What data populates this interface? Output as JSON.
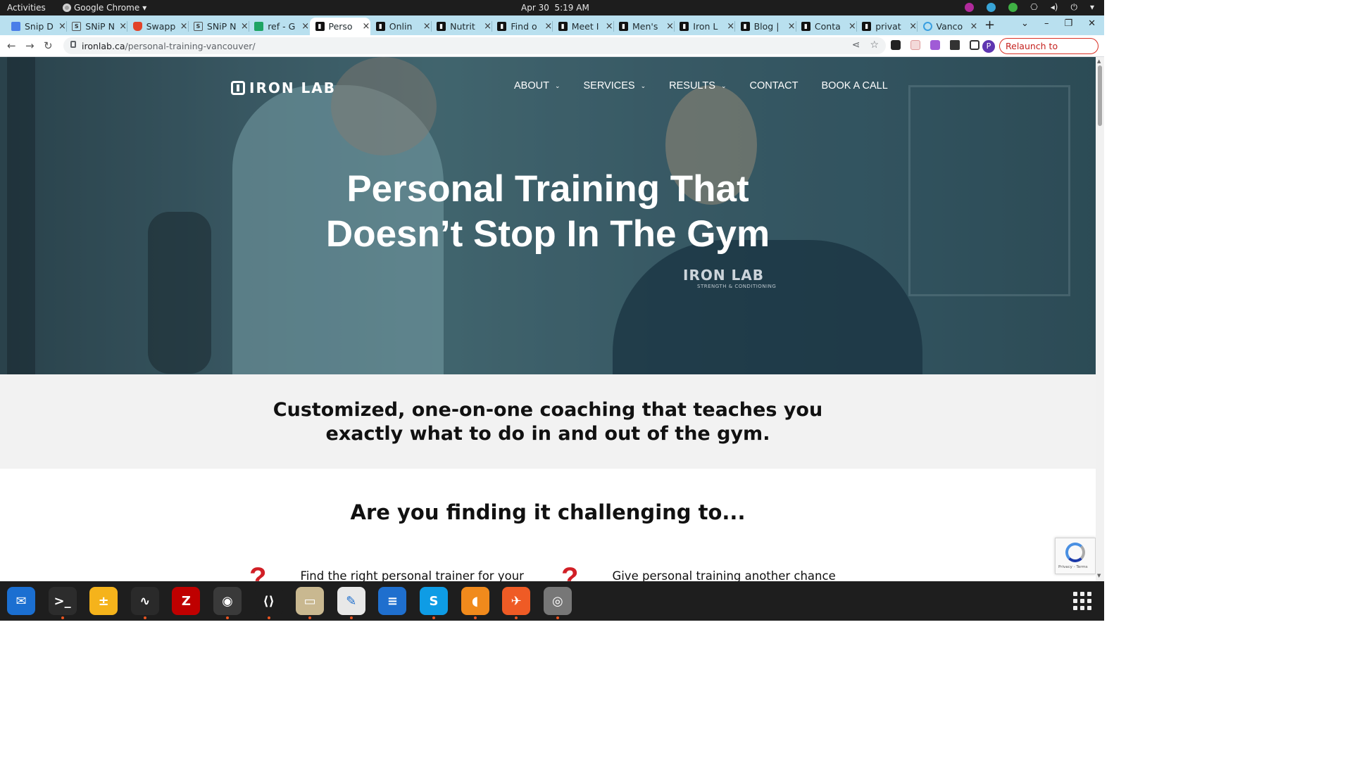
{
  "system_bar": {
    "activities": "Activities",
    "app_name": "Google Chrome",
    "app_menu_arrow": "▾",
    "date": "Apr 30",
    "time": "5:19 AM"
  },
  "tabs": [
    {
      "title": "Snip D",
      "favicon": "doc-icon"
    },
    {
      "title": "SNiP N",
      "favicon": "snip-icon"
    },
    {
      "title": "Swapp",
      "favicon": "gitlab-icon"
    },
    {
      "title": "SNiP N",
      "favicon": "snip-icon"
    },
    {
      "title": "ref - G",
      "favicon": "sheets-icon"
    },
    {
      "title": "Perso",
      "favicon": "ironlab-icon",
      "active": true
    },
    {
      "title": "Onlin",
      "favicon": "ironlab-icon"
    },
    {
      "title": "Nutrit",
      "favicon": "ironlab-icon"
    },
    {
      "title": "Find o",
      "favicon": "ironlab-icon"
    },
    {
      "title": "Meet I",
      "favicon": "ironlab-icon"
    },
    {
      "title": "Men's",
      "favicon": "ironlab-icon"
    },
    {
      "title": "Iron L",
      "favicon": "ironlab-icon"
    },
    {
      "title": "Blog |",
      "favicon": "ironlab-icon"
    },
    {
      "title": "Conta",
      "favicon": "ironlab-icon"
    },
    {
      "title": "privat",
      "favicon": "ironlab-icon"
    },
    {
      "title": "Vanco",
      "favicon": "vancouver-icon"
    }
  ],
  "tab_close": "×",
  "new_tab": "+",
  "window_controls": {
    "dropdown": "⌄",
    "minimize": "–",
    "restore": "❐",
    "close": "✕"
  },
  "address_bar": {
    "domain": "ironlab.ca",
    "path": "/personal-training-vancouver/"
  },
  "toolbar": {
    "back": "←",
    "forward": "→",
    "reload": "↻",
    "share": "⋖",
    "bookmark": "☆",
    "profile_initial": "P",
    "relaunch_label": "Relaunch to update",
    "relaunch_menu": "⋮"
  },
  "site": {
    "logo_text": "IRON LAB",
    "nav": [
      {
        "label": "ABOUT",
        "has_dropdown": true
      },
      {
        "label": "SERVICES",
        "has_dropdown": true
      },
      {
        "label": "RESULTS",
        "has_dropdown": true
      },
      {
        "label": "CONTACT",
        "has_dropdown": false
      },
      {
        "label": "BOOK A CALL",
        "has_dropdown": false
      }
    ],
    "nav_chevron": "⌄",
    "hero_title_line1": "Personal Training That",
    "hero_title_line2": "Doesn’t Stop In The Gym",
    "shirt_logo": "IRON LAB",
    "shirt_sub": "STRENGTH & CONDITIONING",
    "subheading_line1": "Customized, one-on-one coaching that teaches you",
    "subheading_line2": "exactly what to do in and out of the gym.",
    "challenge_heading": "Are you finding it challenging to...",
    "challenges": [
      {
        "mark": "?",
        "text": "Find the right personal trainer for your"
      },
      {
        "mark": "?",
        "text": "Give personal training another chance"
      }
    ]
  },
  "recaptcha": {
    "terms": "Privacy - Terms"
  },
  "dock": [
    {
      "name": "thunderbird-app-icon",
      "glyph": "✉",
      "bg": "#1b6fd1",
      "running": false
    },
    {
      "name": "terminal-app-icon",
      "glyph": ">_",
      "bg": "#2c2c2c",
      "running": true
    },
    {
      "name": "calculator-app-icon",
      "glyph": "±",
      "bg": "#f5b31b",
      "running": false
    },
    {
      "name": "system-monitor-app-icon",
      "glyph": "∿",
      "bg": "#2a2a2a",
      "running": true
    },
    {
      "name": "filezilla-app-icon",
      "glyph": "Z",
      "bg": "#bf0000",
      "running": false
    },
    {
      "name": "chrome-app-icon",
      "glyph": "◉",
      "bg": "#3a3a3a",
      "running": true
    },
    {
      "name": "vscode-app-icon",
      "glyph": "⟨⟩",
      "bg": "#1e1e1e",
      "running": true
    },
    {
      "name": "files-app-icon",
      "glyph": "▭",
      "bg": "#c9b890",
      "running": true
    },
    {
      "name": "text-editor-app-icon",
      "glyph": "✎",
      "bg": "#e8e8e8",
      "running": true
    },
    {
      "name": "writer-app-icon",
      "glyph": "≡",
      "bg": "#1f6fce",
      "running": false
    },
    {
      "name": "skype-app-icon",
      "glyph": "S",
      "bg": "#0e9ce5",
      "running": true
    },
    {
      "name": "hotspot-app-icon",
      "glyph": "◖",
      "bg": "#f08a1c",
      "running": true
    },
    {
      "name": "postman-app-icon",
      "glyph": "✈",
      "bg": "#ef5b25",
      "running": true
    },
    {
      "name": "disk-app-icon",
      "glyph": "◎",
      "bg": "#777777",
      "running": true
    }
  ],
  "colors": {
    "accent_red": "#d11f26",
    "tabstrip": "#b9e0ef",
    "relaunch": "#c5221f"
  }
}
